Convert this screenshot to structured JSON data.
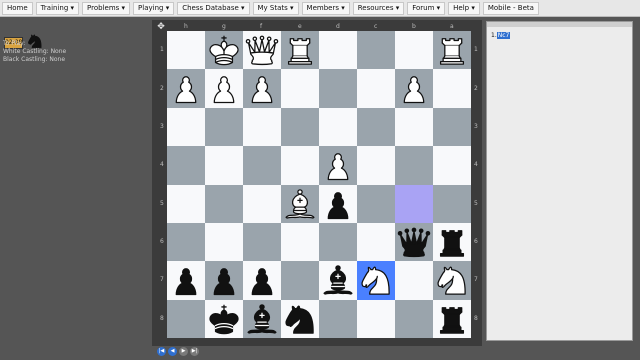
{
  "nav": [
    "Home",
    "Training ▾",
    "Problems ▾",
    "Playing ▾",
    "Chess Database ▾",
    "My Stats ▾",
    "Members ▾",
    "Resources ▾",
    "Forum ▾",
    "Help ▾",
    "Mobile - Beta"
  ],
  "clock": "02:08",
  "info": {
    "to_play": "To Play:",
    "white_castling": "White Castling: None",
    "black_castling": "Black Castling: None"
  },
  "files": [
    "h",
    "g",
    "f",
    "e",
    "d",
    "c",
    "b",
    "a"
  ],
  "ranks": [
    "1",
    "2",
    "3",
    "4",
    "5",
    "6",
    "7",
    "8"
  ],
  "pieces": [
    {
      "sq": "g1",
      "type": "k",
      "color": "w"
    },
    {
      "sq": "f1",
      "type": "q",
      "color": "w"
    },
    {
      "sq": "e1",
      "type": "r",
      "color": "w"
    },
    {
      "sq": "a1",
      "type": "r",
      "color": "w"
    },
    {
      "sq": "h2",
      "type": "p",
      "color": "w"
    },
    {
      "sq": "g2",
      "type": "p",
      "color": "w"
    },
    {
      "sq": "f2",
      "type": "p",
      "color": "w"
    },
    {
      "sq": "b2",
      "type": "p",
      "color": "w"
    },
    {
      "sq": "d4",
      "type": "p",
      "color": "w"
    },
    {
      "sq": "e5",
      "type": "b",
      "color": "w"
    },
    {
      "sq": "d5",
      "type": "p",
      "color": "b"
    },
    {
      "sq": "b6",
      "type": "q",
      "color": "b"
    },
    {
      "sq": "a6",
      "type": "r",
      "color": "b"
    },
    {
      "sq": "h7",
      "type": "p",
      "color": "b"
    },
    {
      "sq": "g7",
      "type": "p",
      "color": "b"
    },
    {
      "sq": "f7",
      "type": "p",
      "color": "b"
    },
    {
      "sq": "d7",
      "type": "b",
      "color": "b"
    },
    {
      "sq": "c7",
      "type": "n",
      "color": "w"
    },
    {
      "sq": "a7",
      "type": "n",
      "color": "w"
    },
    {
      "sq": "g8",
      "type": "k",
      "color": "b"
    },
    {
      "sq": "f8",
      "type": "b",
      "color": "b"
    },
    {
      "sq": "e8",
      "type": "n",
      "color": "b"
    },
    {
      "sq": "a8",
      "type": "r",
      "color": "b"
    }
  ],
  "highlight_from": "b5",
  "highlight_to": "c7",
  "colors": {
    "light": "#f8f9fb",
    "dark": "#9aa4ac",
    "from": "#a9a3f4",
    "to": "#4a80ff"
  },
  "controls": [
    "|◀",
    "◀",
    "▶",
    "▶|"
  ],
  "moves": {
    "number": "1.",
    "selected": "Nc7"
  }
}
